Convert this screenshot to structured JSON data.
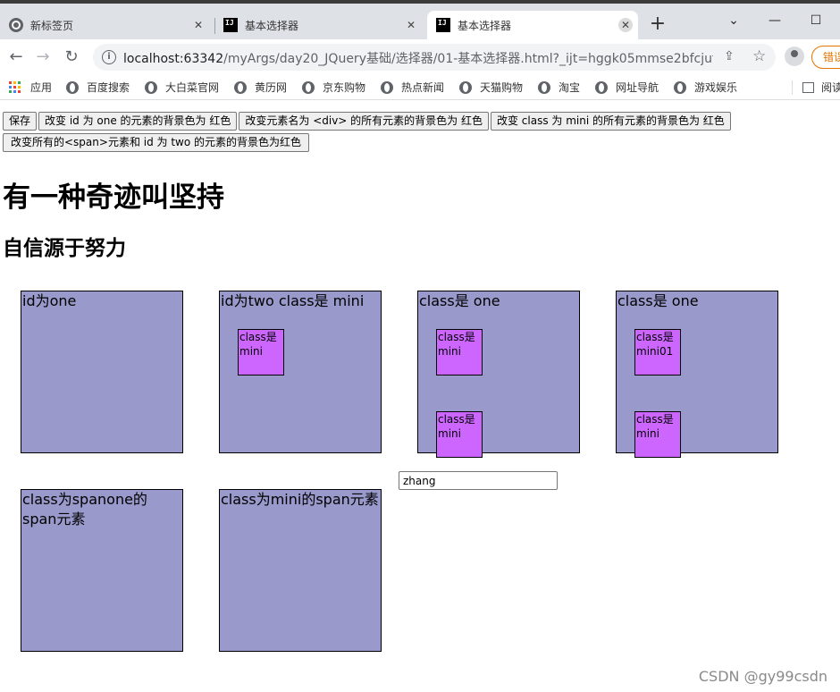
{
  "browser": {
    "tabs": [
      {
        "title": "新标签页",
        "icon": "chrome-icon"
      },
      {
        "title": "基本选择器",
        "icon": "intellij-icon"
      },
      {
        "title": "基本选择器",
        "icon": "intellij-icon"
      }
    ],
    "active_tab": 2,
    "close_glyph": "✕",
    "new_tab_glyph": "+",
    "window_controls": [
      "⌄",
      "—",
      "☐"
    ],
    "address": {
      "host": "localhost:63342",
      "path": "/myArgs/day20_JQuery基础/选择器/01-基本选择器.html?_ijt=hggk05mmse2bfcjuf..."
    },
    "error_button": "错误",
    "bookmarks": [
      {
        "label": "应用",
        "icon": "apps-icon"
      },
      {
        "label": "百度搜索",
        "icon": "globe-icon"
      },
      {
        "label": "大白菜官网",
        "icon": "globe-icon"
      },
      {
        "label": "黄历网",
        "icon": "globe-icon"
      },
      {
        "label": "京东购物",
        "icon": "globe-icon"
      },
      {
        "label": "热点新闻",
        "icon": "globe-icon"
      },
      {
        "label": "天猫购物",
        "icon": "globe-icon"
      },
      {
        "label": "淘宝",
        "icon": "globe-icon"
      },
      {
        "label": "网址导航",
        "icon": "globe-icon"
      },
      {
        "label": "游戏娱乐",
        "icon": "globe-icon"
      }
    ],
    "reading_list": "阅读"
  },
  "page": {
    "buttons": [
      "保存",
      "改变 id 为 one 的元素的背景色为 红色",
      "改变元素名为 <div> 的所有元素的背景色为 红色",
      "改变 class 为 mini 的所有元素的背景色为 红色",
      "改变所有的<span>元素和 id 为 two 的元素的背景色为红色"
    ],
    "heading1": "有一种奇迹叫坚持",
    "heading2": "自信源于努力",
    "boxes": [
      {
        "label": "id为one",
        "minis": []
      },
      {
        "label": "id为two class是 mini",
        "minis": [
          "class是\nmini"
        ]
      },
      {
        "label": "class是 one",
        "minis": [
          "class是\nmini",
          "class是\nmini"
        ]
      },
      {
        "label": "class是 one",
        "minis": [
          "class是\nmini01",
          "class是\nmini"
        ]
      },
      {
        "label": "class为spanone的span元素",
        "minis": []
      },
      {
        "label": "class为mini的span元素",
        "minis": []
      }
    ],
    "text_input_value": "zhang",
    "colors": {
      "box": "#9999cc",
      "mini": "#cc66ff"
    }
  },
  "watermark": "CSDN @gy99csdn"
}
